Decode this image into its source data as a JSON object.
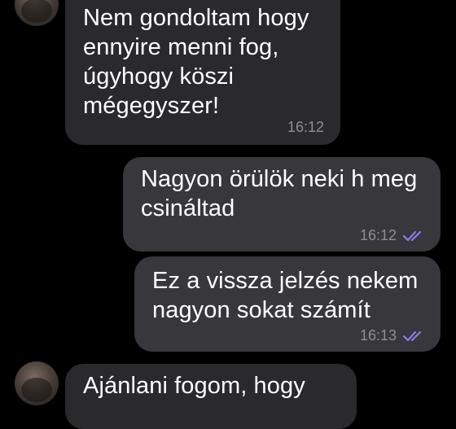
{
  "chat": {
    "messages": [
      {
        "direction": "incoming",
        "text": "Nem gondoltam hogy\nennyire menni fog,\núgyhogy köszi\nmégegyszer!",
        "time": "16:12"
      },
      {
        "direction": "outgoing",
        "text": "Nagyon örülök neki h meg\ncsináltad",
        "time": "16:12",
        "status_icon": "double-check-icon"
      },
      {
        "direction": "outgoing",
        "text": "Ez a vissza jelzés nekem\nnagyon sokat számít",
        "time": "16:13",
        "status_icon": "double-check-icon"
      },
      {
        "direction": "incoming",
        "text": "Ajánlani fogom, hogy",
        "time": ""
      }
    ]
  },
  "colors": {
    "background": "#000000",
    "incoming_bubble": "#2a2a2d",
    "outgoing_bubble": "#37373c",
    "timestamp": "#8e8e93",
    "read_check": "#8c7cf0"
  }
}
